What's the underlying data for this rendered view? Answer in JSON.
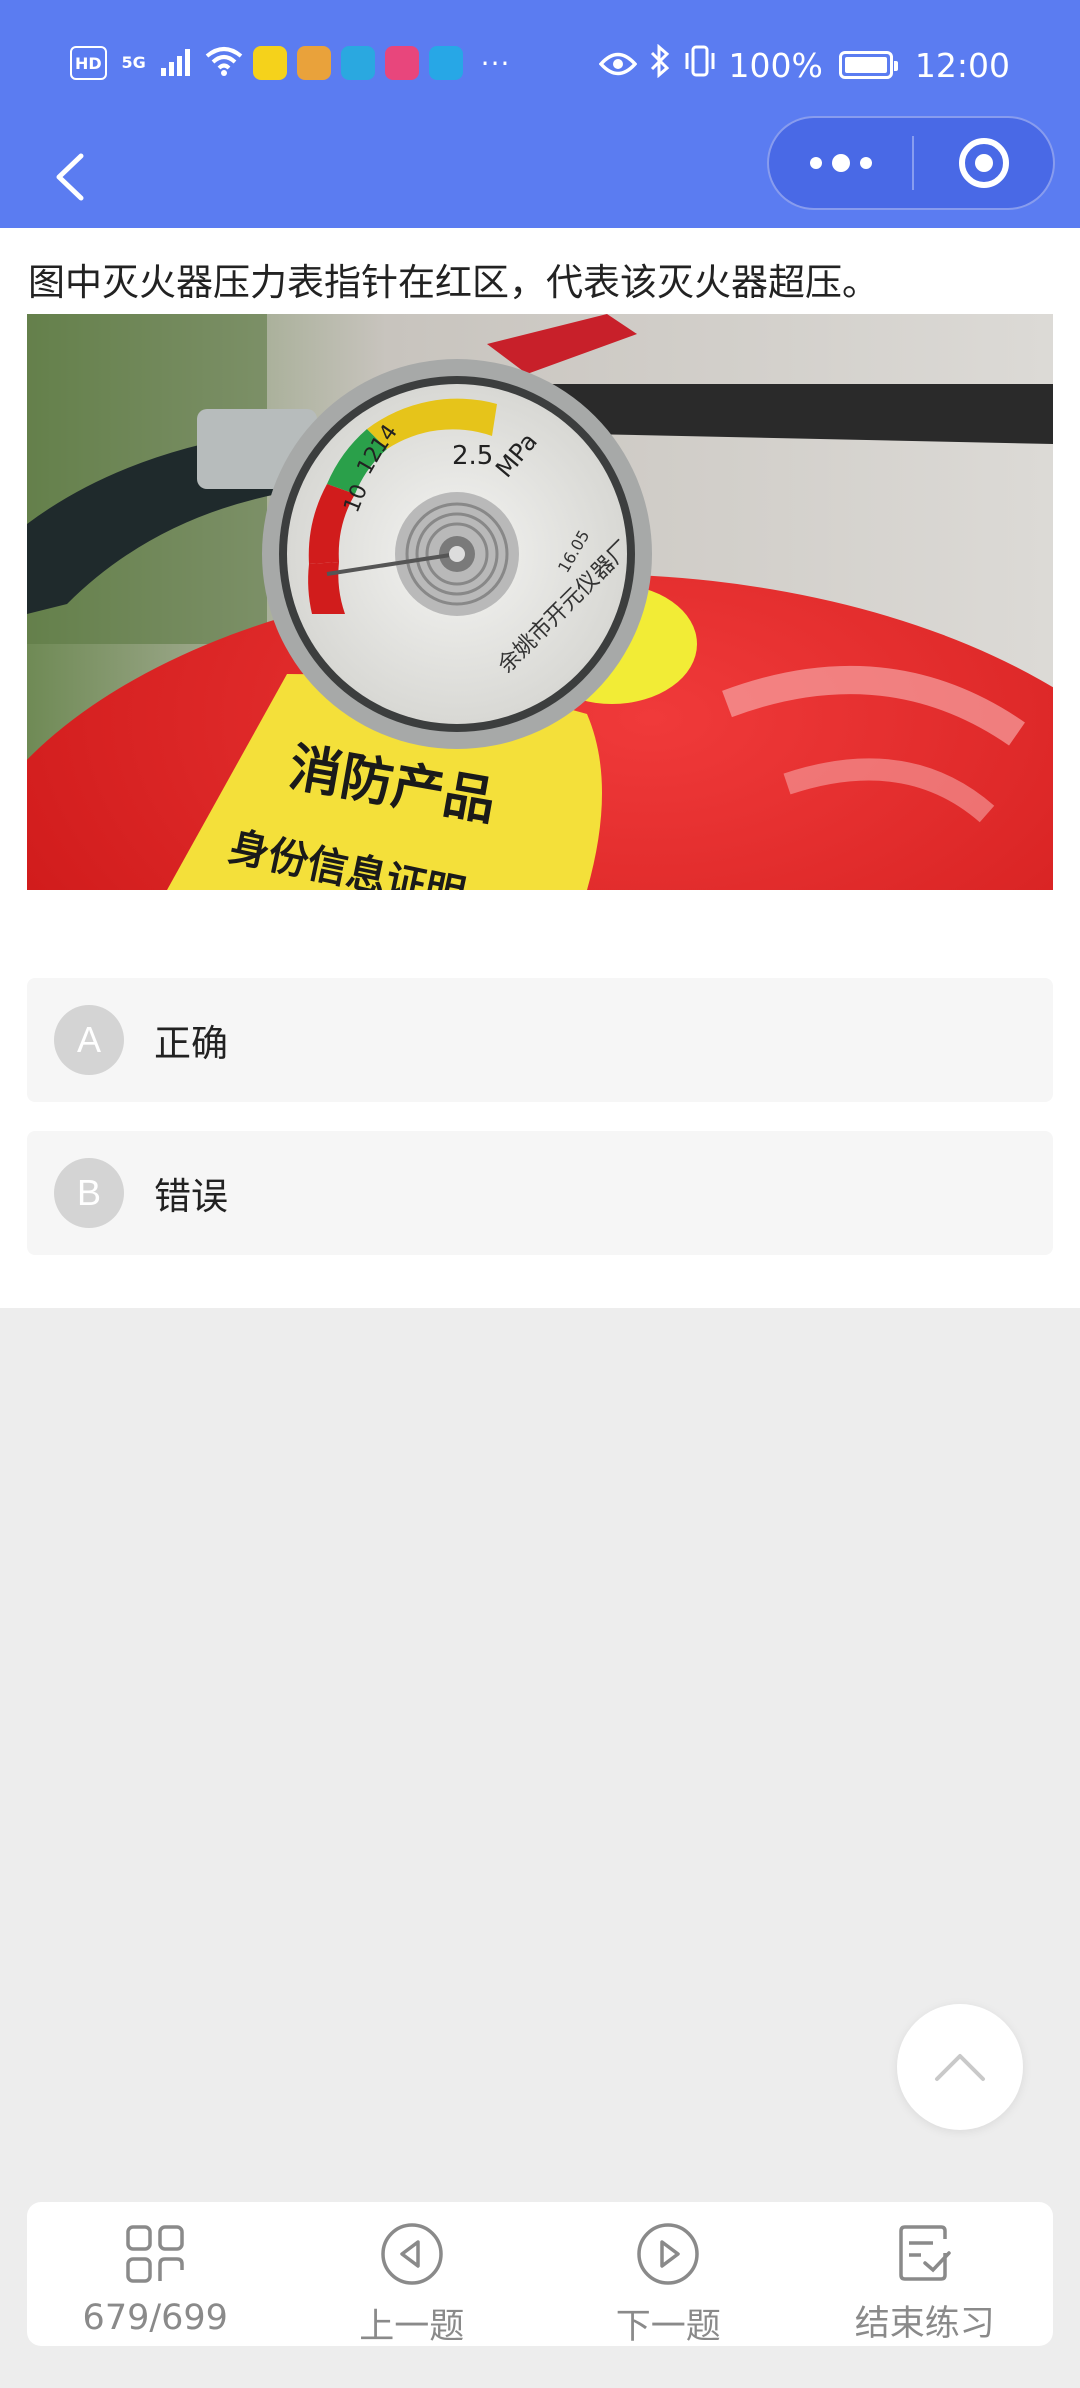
{
  "status_bar": {
    "hd_badge": "HD",
    "network": "5G",
    "battery_percent": "100%",
    "time": "12:00",
    "more": "···",
    "app_icon_colors": [
      "#f5d21b",
      "#e9a23b",
      "#2aa8e0",
      "#e8467c",
      "#27a7e6"
    ]
  },
  "nav": {
    "back_icon": "chevron-left-icon",
    "capsule": {
      "more_icon": "more-dots-icon",
      "close_icon": "target-circle-icon"
    }
  },
  "question": {
    "text": "图中灭火器压力表指针在红区，代表该灭火器超压。",
    "image": {
      "description_icon": "fire-extinguisher-gauge-photo",
      "gauge_scale": [
        "10",
        "12",
        "14",
        "2.5",
        "MPa"
      ],
      "label_line1": "消防产品",
      "label_line2": "身份信息证明",
      "gauge_maker": "余姚市开元仪器厂",
      "gauge_code": "16.05"
    }
  },
  "options": [
    {
      "letter": "A",
      "text": "正确"
    },
    {
      "letter": "B",
      "text": "错误"
    }
  ],
  "scroll_top": {
    "icon": "chevron-up-icon"
  },
  "bottom_bar": {
    "items": [
      {
        "icon": "grid-icon",
        "label": "679/699"
      },
      {
        "icon": "previous-icon",
        "label": "上一题"
      },
      {
        "icon": "next-icon",
        "label": "下一题"
      },
      {
        "icon": "finish-icon",
        "label": "结束练习"
      }
    ]
  },
  "colors": {
    "header": "#5b7cf1",
    "option_bg": "#f6f6f6",
    "option_letter_bg": "#d4d4d4",
    "page_bg": "#ededed",
    "bottom_label": "#8a8a8a"
  }
}
